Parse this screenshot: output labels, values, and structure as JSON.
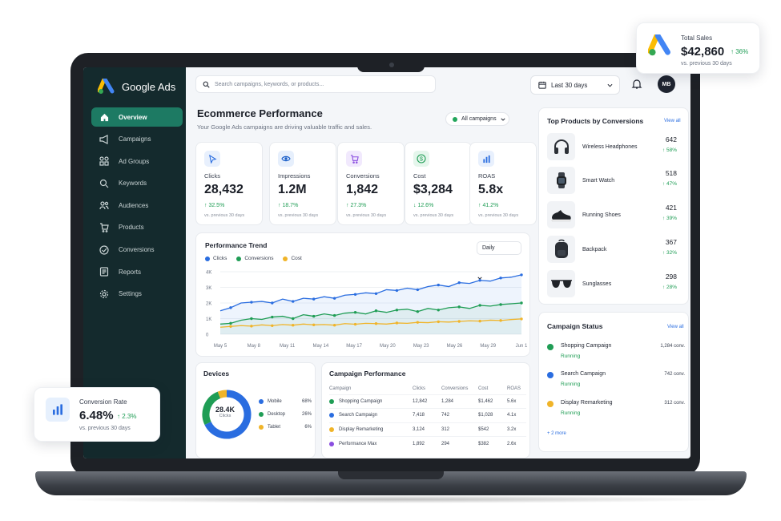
{
  "app": {
    "name": "Google Ads",
    "user_initials": "MB"
  },
  "sidebar": {
    "items": [
      {
        "label": "Overview",
        "icon": "home-icon",
        "active": true
      },
      {
        "label": "Campaigns",
        "icon": "megaphone-icon"
      },
      {
        "label": "Ad Groups",
        "icon": "grid-icon"
      },
      {
        "label": "Keywords",
        "icon": "search-icon"
      },
      {
        "label": "Audiences",
        "icon": "users-icon"
      },
      {
        "label": "Products",
        "icon": "cart-icon"
      },
      {
        "label": "Conversions",
        "icon": "target-icon"
      },
      {
        "label": "Reports",
        "icon": "report-icon"
      },
      {
        "label": "Settings",
        "icon": "gear-icon"
      }
    ]
  },
  "topbar": {
    "search_placeholder": "Search campaigns, keywords, or products...",
    "date_range": "Last 30 days"
  },
  "header": {
    "title": "Ecommerce Performance",
    "subtitle": "Your Google Ads campaigns are driving valuable traffic and sales.",
    "filter": "All campaigns"
  },
  "kpis": [
    {
      "label": "Clicks",
      "value": "28,432",
      "change": "↑ 32.5%",
      "vs": "vs. previous 30 days",
      "icon": "cursor-icon",
      "color": "#2a6de0",
      "bg": "#e8f0fd"
    },
    {
      "label": "Impressions",
      "value": "1.2M",
      "change": "↑ 18.7%",
      "vs": "vs. previous 30 days",
      "icon": "eye-icon",
      "color": "#1a5fc9",
      "bg": "#e6effc"
    },
    {
      "label": "Conversions",
      "value": "1,842",
      "change": "↑ 27.3%",
      "vs": "vs. previous 30 days",
      "icon": "cart-icon",
      "color": "#8a4de0",
      "bg": "#f1e9fd"
    },
    {
      "label": "Cost",
      "value": "$3,284",
      "change": "↓ 12.6%",
      "vs": "vs. previous 30 days",
      "icon": "dollar-icon",
      "color": "#1f9d55",
      "bg": "#e5f6ec"
    },
    {
      "label": "ROAS",
      "value": "5.8x",
      "change": "↑ 41.2%",
      "vs": "vs. previous 30 days",
      "icon": "bar-chart-icon",
      "color": "#2a6de0",
      "bg": "#e8f0fd"
    }
  ],
  "trend": {
    "title": "Performance Trend",
    "interval": "Daily",
    "legend": [
      "Clicks",
      "Conversions",
      "Cost"
    ]
  },
  "chart_data": {
    "type": "line",
    "x": [
      "May 5",
      "May 8",
      "May 11",
      "May 14",
      "May 17",
      "May 20",
      "May 23",
      "May 26",
      "May 29",
      "Jun 1"
    ],
    "y_ticks": [
      "0",
      "1K",
      "2K",
      "3K",
      "4K"
    ],
    "ylim": [
      0,
      4000
    ],
    "series": [
      {
        "name": "Clicks",
        "color": "#2a6de0",
        "values": [
          1500,
          1700,
          2000,
          2050,
          2100,
          2000,
          2250,
          2100,
          2300,
          2250,
          2400,
          2300,
          2500,
          2550,
          2650,
          2600,
          2850,
          2800,
          2950,
          2850,
          3050,
          3150,
          3050,
          3300,
          3250,
          3450,
          3400,
          3600,
          3650,
          3800
        ]
      },
      {
        "name": "Conversions",
        "color": "#1f9d55",
        "values": [
          650,
          700,
          900,
          1000,
          950,
          1100,
          1150,
          1000,
          1250,
          1150,
          1300,
          1200,
          1350,
          1400,
          1300,
          1500,
          1400,
          1550,
          1600,
          1450,
          1650,
          1550,
          1700,
          1750,
          1650,
          1850,
          1800,
          1900,
          1950,
          2000
        ]
      },
      {
        "name": "Cost",
        "color": "#f0b429",
        "values": [
          450,
          500,
          550,
          520,
          600,
          550,
          620,
          580,
          650,
          600,
          620,
          580,
          680,
          640,
          700,
          680,
          650,
          720,
          700,
          760,
          740,
          800,
          780,
          820,
          860,
          840,
          900,
          880,
          940,
          980
        ]
      }
    ]
  },
  "devices": {
    "title": "Devices",
    "total": "28.4K",
    "total_label": "Clicks",
    "rows": [
      {
        "name": "Mobile",
        "pct": "68%",
        "value": 68,
        "color": "#2a6de0"
      },
      {
        "name": "Desktop",
        "pct": "26%",
        "value": 26,
        "color": "#1f9d55"
      },
      {
        "name": "Tablet",
        "pct": "6%",
        "value": 6,
        "color": "#f0b429"
      }
    ]
  },
  "campaign_performance": {
    "title": "Campaign Performance",
    "headers": [
      "Campaign",
      "Clicks",
      "Conversions",
      "Cost",
      "ROAS"
    ],
    "rows": [
      {
        "name": "Shopping Campaign",
        "clicks": "12,842",
        "conv": "1,284",
        "cost": "$1,462",
        "roas": "5.6x",
        "color": "#1f9d55"
      },
      {
        "name": "Search Campaign",
        "clicks": "7,418",
        "conv": "742",
        "cost": "$1,028",
        "roas": "4.1x",
        "color": "#2a6de0"
      },
      {
        "name": "Display Remarketing",
        "clicks": "3,124",
        "conv": "312",
        "cost": "$542",
        "roas": "3.2x",
        "color": "#f0b429"
      },
      {
        "name": "Performance Max",
        "clicks": "1,892",
        "conv": "294",
        "cost": "$382",
        "roas": "2.6x",
        "color": "#8a4de0"
      }
    ]
  },
  "top_products": {
    "title": "Top Products by Conversions",
    "view_all": "View all",
    "items": [
      {
        "name": "Wireless Headphones",
        "count": "642",
        "change": "↑ 58%",
        "icon": "headphones-icon"
      },
      {
        "name": "Smart Watch",
        "count": "518",
        "change": "↑ 47%",
        "icon": "watch-icon"
      },
      {
        "name": "Running Shoes",
        "count": "421",
        "change": "↑ 39%",
        "icon": "shoe-icon"
      },
      {
        "name": "Backpack",
        "count": "367",
        "change": "↑ 32%",
        "icon": "backpack-icon"
      },
      {
        "name": "Sunglasses",
        "count": "298",
        "change": "↑ 28%",
        "icon": "sunglasses-icon"
      }
    ]
  },
  "campaign_status": {
    "title": "Campaign Status",
    "view_all": "View all",
    "items": [
      {
        "name": "Shopping Campaign",
        "status": "Running",
        "conv": "1,284 conv.",
        "color": "#1f9d55"
      },
      {
        "name": "Search Campaign",
        "status": "Running",
        "conv": "742 conv.",
        "color": "#2a6de0"
      },
      {
        "name": "Display Remarketing",
        "status": "Running",
        "conv": "312 conv.",
        "color": "#f0b429"
      }
    ],
    "more": "+ 2 more"
  },
  "float_sales": {
    "label": "Total Sales",
    "value": "$42,860",
    "change": "↑ 36%",
    "vs": "vs. previous 30 days"
  },
  "float_conversion": {
    "label": "Conversion Rate",
    "value": "6.48%",
    "change": "↑ 2.3%",
    "vs": "vs. previous 30 days"
  }
}
